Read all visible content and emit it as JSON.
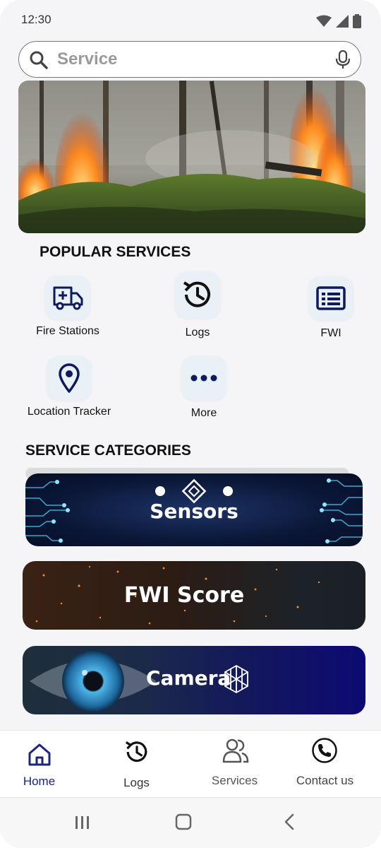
{
  "status_bar": {
    "time": "12:30"
  },
  "search": {
    "placeholder": "Service"
  },
  "popular": {
    "title": "POPULAR SERVICES",
    "items": [
      {
        "label": "Fire Stations",
        "icon": "ambulance-icon"
      },
      {
        "label": "Logs",
        "icon": "history-icon"
      },
      {
        "label": "FWI",
        "icon": "document-list-icon"
      },
      {
        "label": "Location Tracker",
        "icon": "location-pin-icon"
      },
      {
        "label": "More",
        "icon": "more-dots-icon"
      }
    ]
  },
  "categories": {
    "title": "SERVICE CATEGORIES",
    "items": [
      {
        "label": "Sensors"
      },
      {
        "label": "FWI Score"
      },
      {
        "label": "Camera"
      }
    ]
  },
  "bottom_nav": {
    "items": [
      {
        "label": "Home",
        "icon": "home-icon",
        "active": true
      },
      {
        "label": "Logs",
        "icon": "history-icon",
        "active": false
      },
      {
        "label": "Services",
        "icon": "users-icon",
        "active": false
      },
      {
        "label": "Contact us",
        "icon": "phone-icon",
        "active": false
      }
    ]
  },
  "colors": {
    "accent": "#1a237e",
    "icon_dark": "#0d1b5e",
    "tile_bg": "#e9f1f7",
    "background": "#f5f5f7"
  }
}
